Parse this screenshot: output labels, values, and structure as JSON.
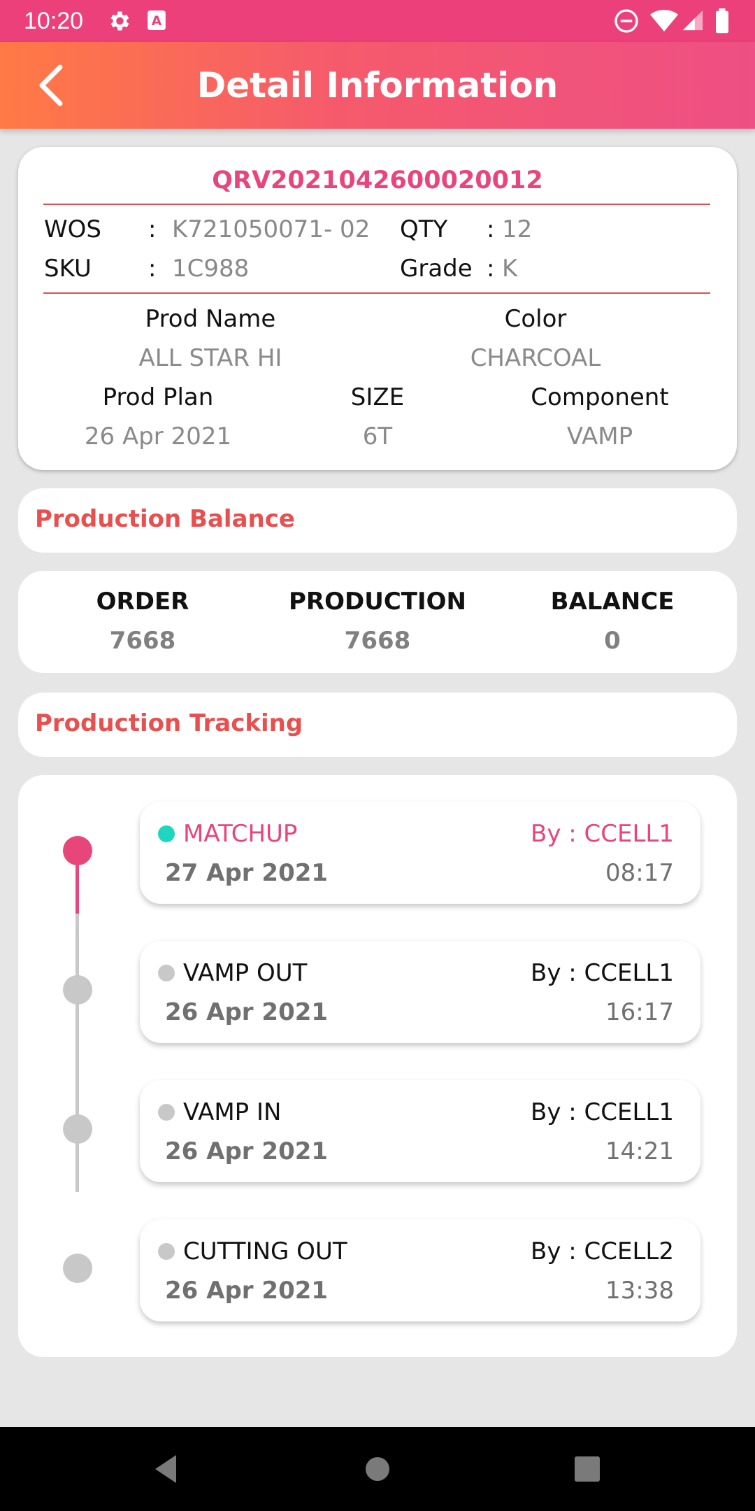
{
  "status_bar": {
    "time": "10:20"
  },
  "header": {
    "title": "Detail Information"
  },
  "info": {
    "code": "QRV2021042600020012",
    "wos_label": "WOS",
    "wos_value": "K721050071- 02",
    "qty_label": "QTY",
    "qty_value": "12",
    "sku_label": "SKU",
    "sku_value": "1C988",
    "grade_label": "Grade",
    "grade_value": "K",
    "colon": ":",
    "prod_name_label": "Prod Name",
    "prod_name_value": "ALL STAR HI",
    "color_label": "Color",
    "color_value": "CHARCOAL",
    "prod_plan_label": "Prod Plan",
    "prod_plan_value": "26 Apr 2021",
    "size_label": "SIZE",
    "size_value": "6T",
    "component_label": "Component",
    "component_value": "VAMP"
  },
  "production_balance": {
    "title": "Production Balance",
    "order_label": "ORDER",
    "order_value": "7668",
    "production_label": "PRODUCTION",
    "production_value": "7668",
    "balance_label": "BALANCE",
    "balance_value": "0"
  },
  "production_tracking": {
    "title": "Production Tracking",
    "items": [
      {
        "stage": "MATCHUP",
        "by": "By : CCELL1",
        "date": "27 Apr 2021",
        "time": "08:17",
        "active": true
      },
      {
        "stage": "VAMP OUT",
        "by": "By : CCELL1",
        "date": "26 Apr 2021",
        "time": "16:17",
        "active": false
      },
      {
        "stage": "VAMP IN",
        "by": "By : CCELL1",
        "date": "26 Apr 2021",
        "time": "14:21",
        "active": false
      },
      {
        "stage": "CUTTING OUT",
        "by": "By : CCELL2",
        "date": "26 Apr 2021",
        "time": "13:38",
        "active": false
      }
    ]
  },
  "colors": {
    "accent_pink": "#e8457b",
    "section_red": "#e8504f",
    "active_bullet": "#1ed6c0",
    "inactive_gray": "#c8c8c8"
  },
  "icons": {
    "status": [
      "gear-icon",
      "keyboard-a-icon",
      "do-not-disturb-icon",
      "wifi-icon",
      "signal-icon",
      "battery-icon"
    ],
    "header": "back-chevron-icon",
    "nav": [
      "nav-back-icon",
      "nav-home-icon",
      "nav-recents-icon"
    ]
  }
}
